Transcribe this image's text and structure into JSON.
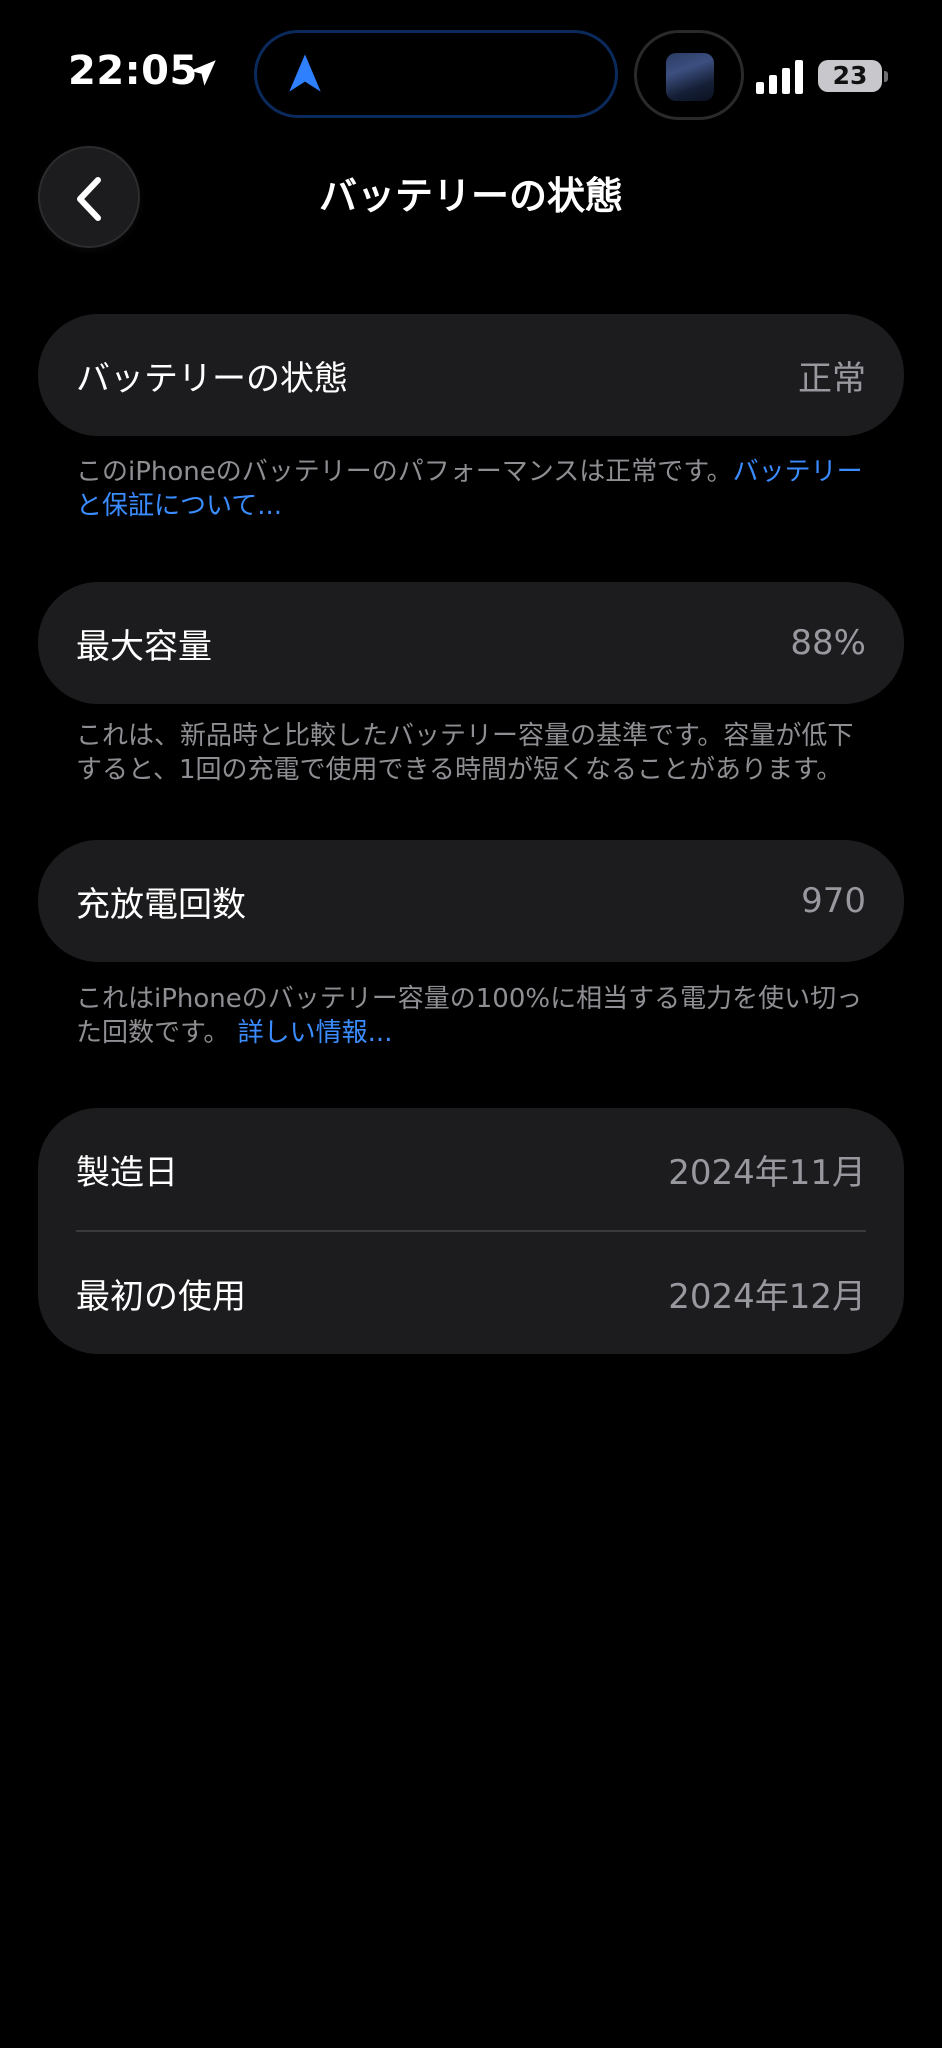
{
  "status_bar": {
    "time": "22:05",
    "battery_level": "23",
    "icons": [
      "location-arrow-icon",
      "navigation-arrow-icon",
      "cellular-signal-icon",
      "battery-icon"
    ]
  },
  "header": {
    "title": "バッテリーの状態",
    "back_icon": "chevron-left-icon"
  },
  "battery_state": {
    "label": "バッテリーの状態",
    "value": "正常",
    "note": "このiPhoneのバッテリーのパフォーマンスは正常です。",
    "note_link": "バッテリーと保証について..."
  },
  "max_capacity": {
    "label": "最大容量",
    "value": "88%",
    "note": "これは、新品時と比較したバッテリー容量の基準です。容量が低下すると、1回の充電で使用できる時間が短くなることがあります。"
  },
  "cycle_count": {
    "label": "充放電回数",
    "value": "970",
    "note": "これはiPhoneのバッテリー容量の100%に相当する電力を使い切った回数です。",
    "note_link": "詳しい情報..."
  },
  "dates": {
    "manufacture_label": "製造日",
    "manufacture_value": "2024年11月",
    "first_use_label": "最初の使用",
    "first_use_value": "2024年12月"
  },
  "colors": {
    "background": "#000000",
    "card": "#1c1c1e",
    "secondary_text": "#98989f",
    "link": "#3a8cff"
  }
}
